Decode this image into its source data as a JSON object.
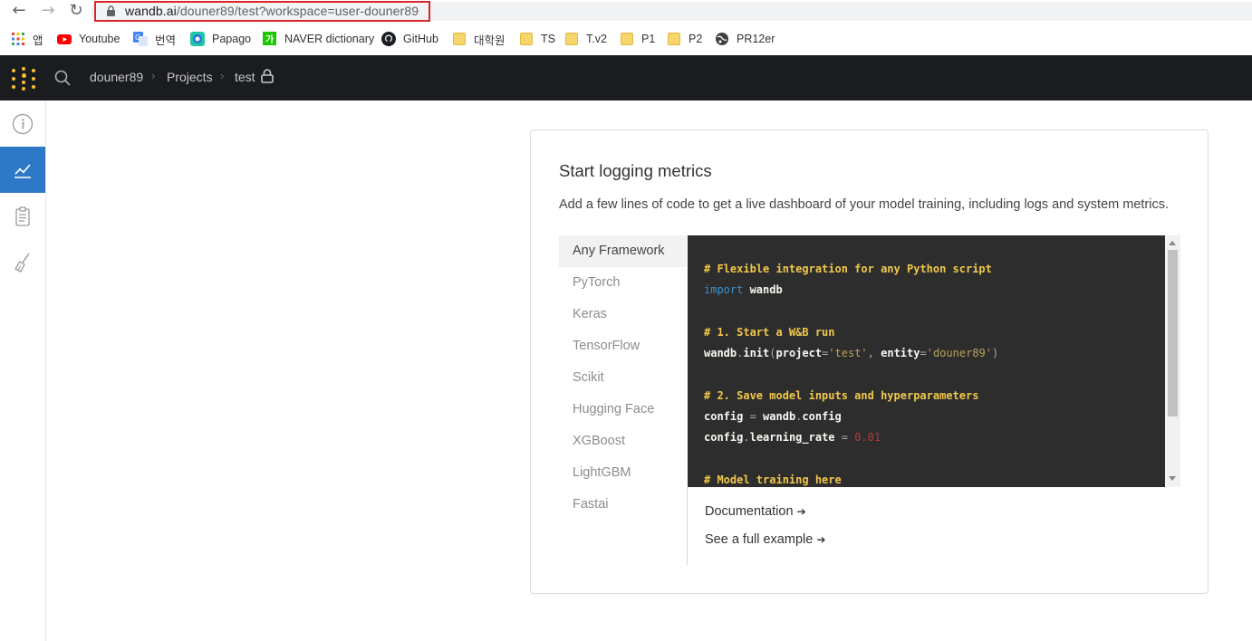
{
  "browser": {
    "url_host": "wandb.ai",
    "url_rest": "/douner89/test?workspace=user-douner89",
    "bookmarks": [
      {
        "label": "앱",
        "icon": "apps-grid-icon"
      },
      {
        "label": "Youtube",
        "icon": "youtube-icon"
      },
      {
        "label": "번역",
        "icon": "google-translate-icon"
      },
      {
        "label": "Papago",
        "icon": "papago-icon"
      },
      {
        "label": "NAVER dictionary",
        "icon": "naver-icon"
      },
      {
        "label": "GitHub",
        "icon": "github-icon"
      },
      {
        "label": "대학원",
        "icon": "folder-icon"
      },
      {
        "label": "TS",
        "icon": "folder-icon"
      },
      {
        "label": "T.v2",
        "icon": "folder-icon"
      },
      {
        "label": "P1",
        "icon": "folder-icon"
      },
      {
        "label": "P2",
        "icon": "folder-icon"
      },
      {
        "label": "PR12er",
        "icon": "globe-icon"
      }
    ]
  },
  "header": {
    "breadcrumb": [
      "douner89",
      "Projects",
      "test"
    ]
  },
  "card": {
    "title": "Start logging metrics",
    "subtitle": "Add a few lines of code to get a live dashboard of your model training, including logs and system metrics.",
    "frameworks": [
      "Any Framework",
      "PyTorch",
      "Keras",
      "TensorFlow",
      "Scikit",
      "Hugging Face",
      "XGBoost",
      "LightGBM",
      "Fastai"
    ],
    "selected_framework": "Any Framework",
    "code": {
      "c1": "# Flexible integration for any Python script",
      "l2_kw": "import",
      "l2_rest": " wandb",
      "c3": "# 1. Start a W&B run",
      "l4_a": "wandb",
      "l4_b": ".",
      "l4_c": "init",
      "l4_d": "(",
      "l4_e": "project",
      "l4_f": "=",
      "l4_g": "'test'",
      "l4_h": ", ",
      "l4_i": "entity",
      "l4_j": "=",
      "l4_k": "'douner89'",
      "l4_l": ")",
      "c5": "# 2. Save model inputs and hyperparameters",
      "l6_a": "config",
      "l6_b": " = ",
      "l6_c": "wandb",
      "l6_d": ".",
      "l6_e": "config",
      "l7_a": "config",
      "l7_b": ".",
      "l7_c": "learning_rate",
      "l7_d": " = ",
      "l7_e": "0.01",
      "c8": "# Model training here"
    },
    "links": {
      "docs": "Documentation",
      "example": "See a full example",
      "arrow": "➔"
    }
  },
  "colors": {
    "accent": "#2e79c7",
    "header_bg": "#1a1c1f",
    "logo_dots": "#fcbc32"
  }
}
